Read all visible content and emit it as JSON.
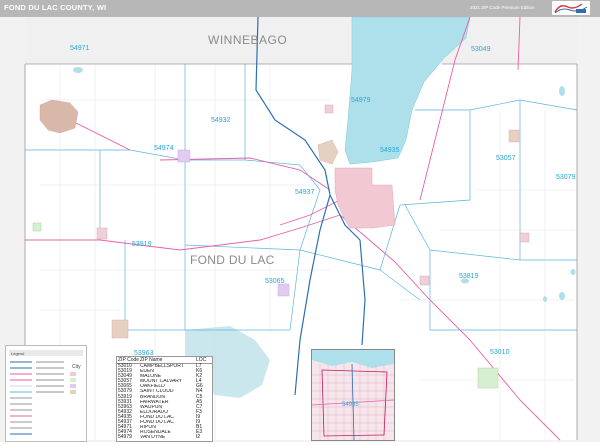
{
  "header": {
    "title": "FOND DU LAC COUNTY, WI",
    "edition": "2021 ZIP Code Premium Edition"
  },
  "map": {
    "county_labels": [
      "WINNEBAGO",
      "FOND DU LAC"
    ],
    "zip_labels": [
      "54971",
      "54979",
      "54932",
      "54974",
      "54935",
      "54937",
      "53919",
      "53065",
      "53057",
      "53079",
      "53049",
      "53819",
      "53010",
      "53963"
    ],
    "colors": {
      "water": "#aee0ec",
      "urban": "#f2c9d2",
      "zip_label": "#29a6d4",
      "county_label": "#8a8a8a",
      "highway": "#2e6eb5",
      "road": "#e85fa8",
      "zip_boundary": "#5ab5e0"
    }
  },
  "zip_table": {
    "headers": {
      "zip": "ZIP Code",
      "name": "ZIP Name",
      "loc": "LOC"
    },
    "rows": [
      {
        "zip": "53010",
        "name": "CAMPBELLSPORT",
        "loc": "L7"
      },
      {
        "zip": "53019",
        "name": "EDEN",
        "loc": "K6"
      },
      {
        "zip": "53049",
        "name": "MALONE",
        "loc": "K2"
      },
      {
        "zip": "53057",
        "name": "MOUNT CALVARY",
        "loc": "L4"
      },
      {
        "zip": "53065",
        "name": "OAKFIELD",
        "loc": "G6"
      },
      {
        "zip": "53079",
        "name": "SAINT CLOUD",
        "loc": "N4"
      },
      {
        "zip": "53919",
        "name": "BRANDON",
        "loc": "C5"
      },
      {
        "zip": "53931",
        "name": "FAIRWATER",
        "loc": "A5"
      },
      {
        "zip": "53963",
        "name": "WAUPUN",
        "loc": "C7"
      },
      {
        "zip": "54932",
        "name": "ELDORADO",
        "loc": "F3"
      },
      {
        "zip": "54935",
        "name": "FOND DU LAC",
        "loc": "I9"
      },
      {
        "zip": "54937",
        "name": "FOND DU LAC",
        "loc": "I9"
      },
      {
        "zip": "54971",
        "name": "RIPON",
        "loc": "B1"
      },
      {
        "zip": "54974",
        "name": "ROSENDALE",
        "loc": "E3"
      },
      {
        "zip": "54979",
        "name": "VAN DYNE",
        "loc": "I2"
      }
    ]
  },
  "inset": {
    "zip_label": "54935"
  },
  "legend": {
    "title": "Legend",
    "city_label": "City"
  }
}
